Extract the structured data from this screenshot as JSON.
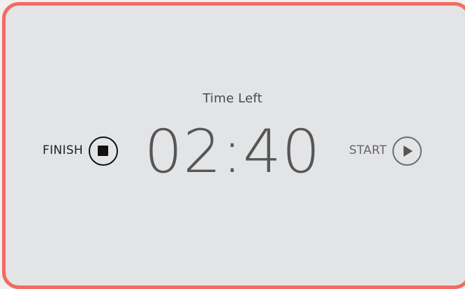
{
  "timer": {
    "label": "Time Left",
    "value": "02:40"
  },
  "controls": {
    "finish_label": "FINISH",
    "start_label": "START"
  },
  "icons": {
    "finish": "stop-icon",
    "start": "play-icon"
  },
  "colors": {
    "accent_border": "#f26b62",
    "card_background": "#e3e4e6",
    "timer_text": "#565656"
  }
}
